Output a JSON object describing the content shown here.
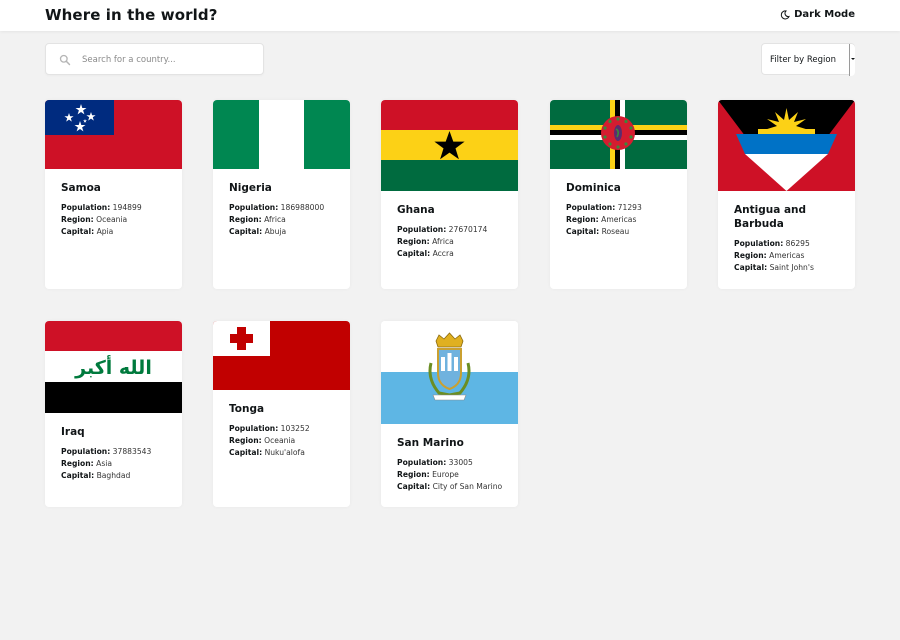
{
  "header": {
    "title": "Where in the world?",
    "mode_label": "Dark Mode"
  },
  "search": {
    "placeholder": "Search for a country..."
  },
  "filter": {
    "label": "Filter by Region"
  },
  "labels": {
    "population": "Population:",
    "region": "Region:",
    "capital": "Capital:"
  },
  "countries": [
    {
      "name": "Samoa",
      "population": "194899",
      "region": "Oceania",
      "capital": "Apia"
    },
    {
      "name": "Nigeria",
      "population": "186988000",
      "region": "Africa",
      "capital": "Abuja"
    },
    {
      "name": "Ghana",
      "population": "27670174",
      "region": "Africa",
      "capital": "Accra"
    },
    {
      "name": "Dominica",
      "population": "71293",
      "region": "Americas",
      "capital": "Roseau"
    },
    {
      "name": "Antigua and Barbuda",
      "population": "86295",
      "region": "Americas",
      "capital": "Saint John's"
    },
    {
      "name": "Iraq",
      "population": "37883543",
      "region": "Asia",
      "capital": "Baghdad"
    },
    {
      "name": "Tonga",
      "population": "103252",
      "region": "Oceania",
      "capital": "Nuku'alofa"
    },
    {
      "name": "San Marino",
      "population": "33005",
      "region": "Europe",
      "capital": "City of San Marino"
    }
  ],
  "flag_text": {
    "iraq": "الله أكبر"
  },
  "colors": {
    "background": "#f2f2f2",
    "card": "#ffffff",
    "text": "#111517"
  }
}
